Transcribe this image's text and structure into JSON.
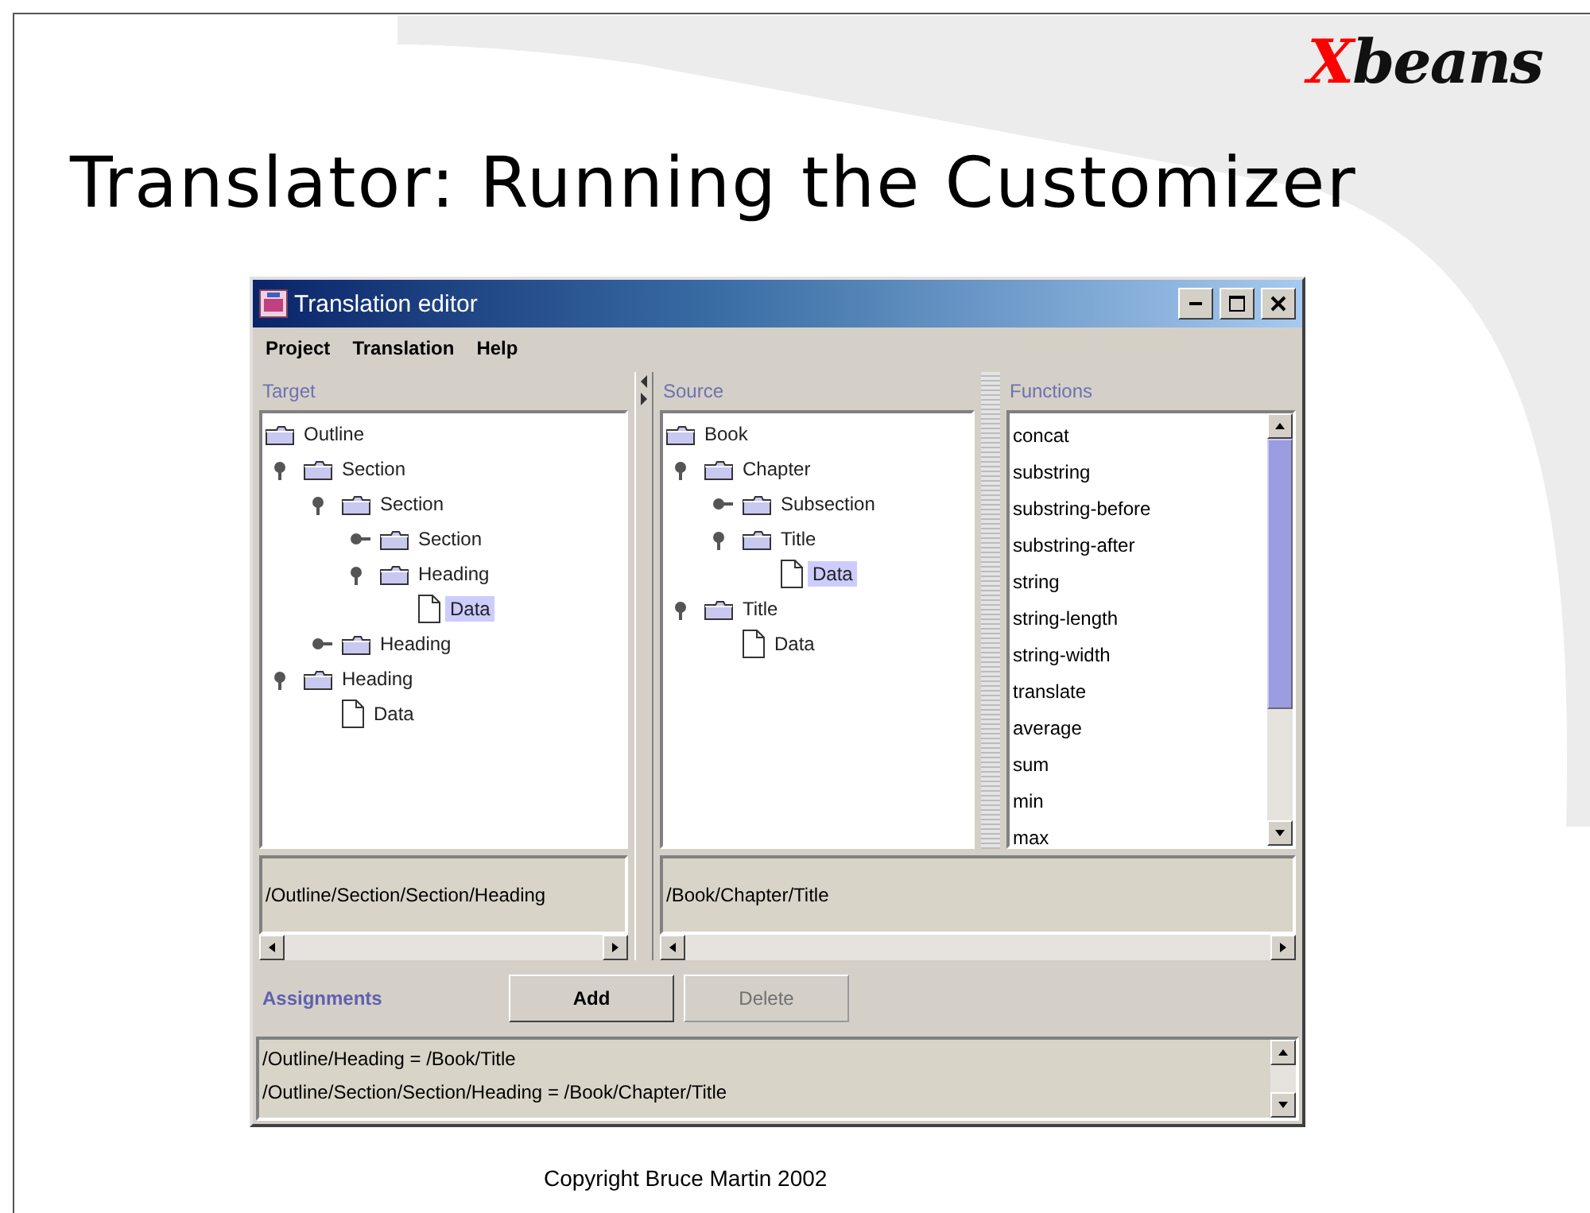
{
  "slide": {
    "logo": "Xbeans",
    "title": "Translator: Running the Customizer",
    "footer": "Copyright Bruce Martin 2002"
  },
  "window": {
    "title": "Translation editor",
    "menu": [
      "Project",
      "Translation",
      "Help"
    ],
    "target": {
      "label": "Target",
      "path": "/Outline/Section/Section/Heading",
      "tree": [
        {
          "kind": "folder",
          "label": "Outline",
          "selected": false,
          "children": [
            {
              "kind": "folder",
              "label": "Section",
              "expanded": true,
              "selected": false,
              "children": [
                {
                  "kind": "folder",
                  "label": "Section",
                  "expanded": true,
                  "selected": false,
                  "children": [
                    {
                      "kind": "folder",
                      "label": "Section",
                      "expanded": false,
                      "selected": false
                    },
                    {
                      "kind": "folder",
                      "label": "Heading",
                      "expanded": true,
                      "selected": false,
                      "children": [
                        {
                          "kind": "file",
                          "label": "Data",
                          "selected": true
                        }
                      ]
                    }
                  ]
                },
                {
                  "kind": "folder",
                  "label": "Heading",
                  "expanded": false,
                  "selected": false
                }
              ]
            },
            {
              "kind": "folder",
              "label": "Heading",
              "expanded": true,
              "selected": false,
              "children": [
                {
                  "kind": "file",
                  "label": "Data",
                  "selected": false
                }
              ]
            }
          ]
        }
      ]
    },
    "source": {
      "label": "Source",
      "path": "/Book/Chapter/Title",
      "tree": [
        {
          "kind": "folder",
          "label": "Book",
          "selected": false,
          "children": [
            {
              "kind": "folder",
              "label": "Chapter",
              "expanded": true,
              "selected": false,
              "children": [
                {
                  "kind": "folder",
                  "label": "Subsection",
                  "expanded": false,
                  "selected": false
                },
                {
                  "kind": "folder",
                  "label": "Title",
                  "expanded": true,
                  "selected": false,
                  "children": [
                    {
                      "kind": "file",
                      "label": "Data",
                      "selected": true
                    }
                  ]
                }
              ]
            },
            {
              "kind": "folder",
              "label": "Title",
              "expanded": true,
              "selected": false,
              "children": [
                {
                  "kind": "file",
                  "label": "Data",
                  "selected": false
                }
              ]
            }
          ]
        }
      ]
    },
    "functions": {
      "label": "Functions",
      "items": [
        "concat",
        "substring",
        "substring-before",
        "substring-after",
        "string",
        "string-length",
        "string-width",
        "translate",
        "average",
        "sum",
        "min",
        "max"
      ]
    },
    "assignments": {
      "label": "Assignments",
      "buttons": [
        {
          "label": "Add",
          "disabled": false
        },
        {
          "label": "Delete",
          "disabled": true
        }
      ],
      "items": [
        "/Outline/Heading = /Book/Title",
        "/Outline/Section/Section/Heading = /Book/Chapter/Title"
      ]
    }
  }
}
